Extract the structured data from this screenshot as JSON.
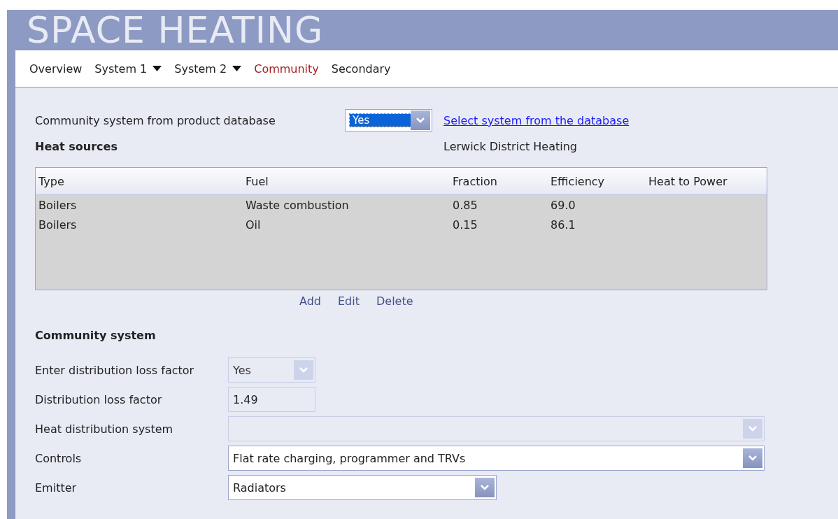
{
  "title": "SPACE HEATING",
  "tabs": [
    {
      "label": "Overview",
      "selected": false,
      "dropdown": false
    },
    {
      "label": "System 1",
      "selected": false,
      "dropdown": true
    },
    {
      "label": "System 2",
      "selected": false,
      "dropdown": true
    },
    {
      "label": "Community",
      "selected": true,
      "dropdown": false
    },
    {
      "label": "Secondary",
      "selected": false,
      "dropdown": false
    }
  ],
  "database": {
    "label": "Community system from product database",
    "value": "Yes",
    "link": "Select system from the database"
  },
  "heat_sources": {
    "heading": "Heat sources",
    "system_name": "Lerwick District Heating",
    "columns": [
      "Type",
      "Fuel",
      "Fraction",
      "Efficiency",
      "Heat to Power"
    ],
    "rows": [
      [
        "Boilers",
        "Waste combustion",
        "0.85",
        "69.0"
      ],
      [
        "Boilers",
        "Oil",
        "0.15",
        "86.1"
      ]
    ],
    "actions": [
      "Add",
      "Edit",
      "Delete"
    ]
  },
  "community": {
    "heading": "Community system",
    "fields": [
      {
        "label": "Enter distribution loss factor",
        "kind": "combo",
        "value": "Yes",
        "disabled": true
      },
      {
        "label": "Distribution loss factor",
        "kind": "text",
        "value": "1.49",
        "disabled": true
      },
      {
        "label": "Heat distribution system",
        "kind": "combo",
        "disabled": true
      },
      {
        "label": "Controls",
        "kind": "combo",
        "value": "Flat rate charging, programmer and TRVs",
        "disabled": false
      },
      {
        "label": "Emitter",
        "kind": "combo",
        "value": "Radiators",
        "disabled": false
      }
    ]
  }
}
